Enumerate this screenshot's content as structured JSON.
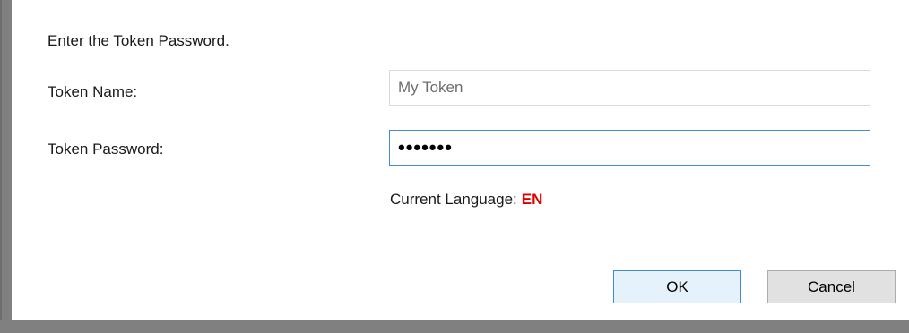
{
  "dialog": {
    "instruction": "Enter the Token Password.",
    "token_name_label": "Token Name:",
    "token_name_value": "My Token",
    "token_password_label": "Token Password:",
    "token_password_value": "•••••••",
    "language_label": "Current Language:",
    "language_code": "EN",
    "ok_label": "OK",
    "cancel_label": "Cancel"
  },
  "colors": {
    "focus_border": "#3c8ed6",
    "language_code": "#e00000",
    "window_border": "#808080"
  }
}
